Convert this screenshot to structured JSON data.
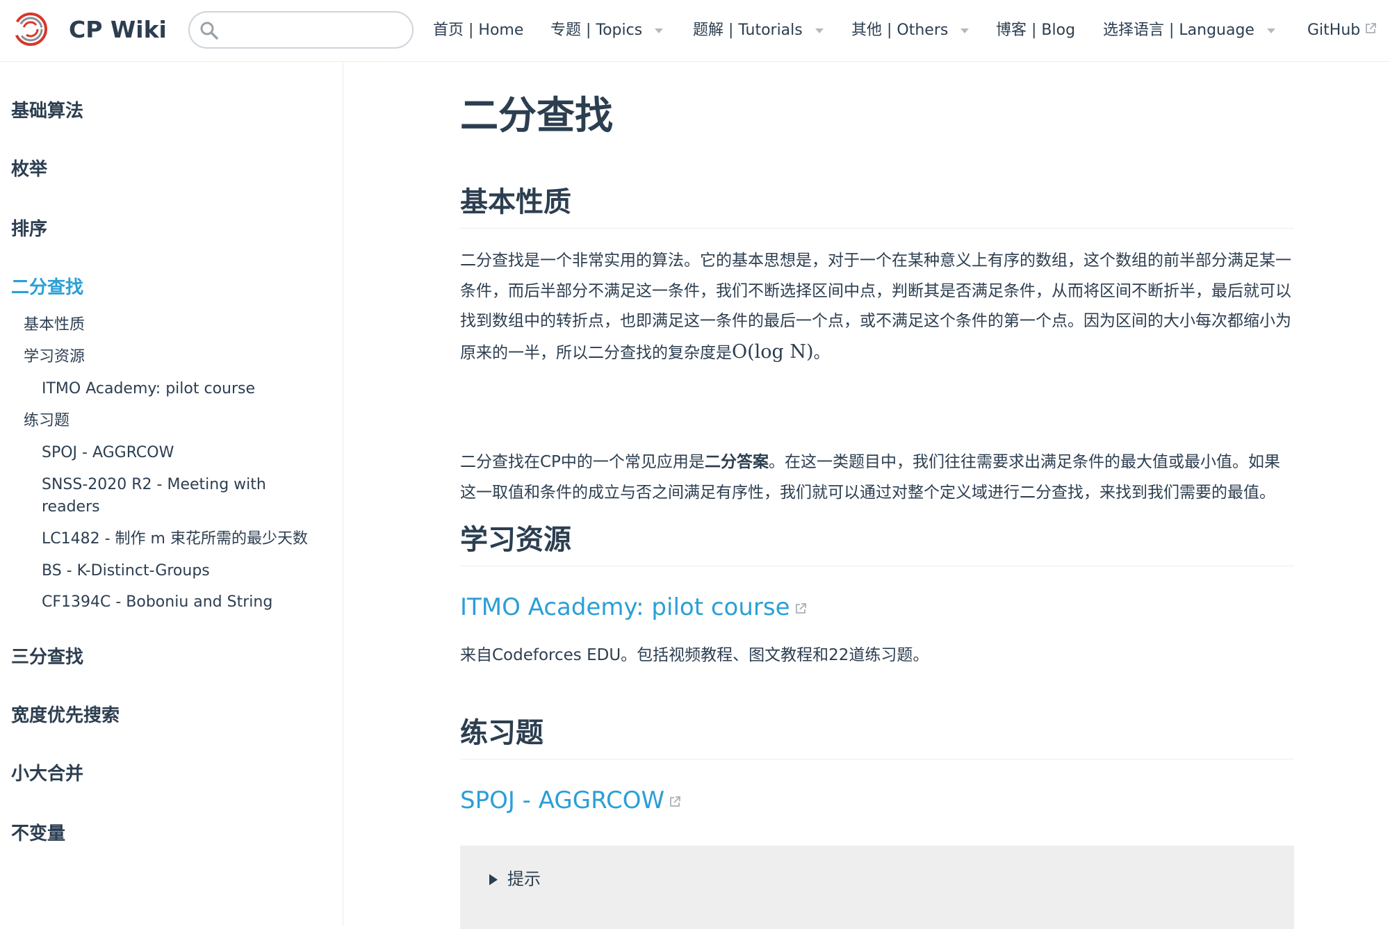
{
  "navbar": {
    "site_name": "CP Wiki",
    "search_placeholder": "",
    "items": [
      {
        "label": "首页 | Home"
      },
      {
        "label": "专题 | Topics"
      },
      {
        "label": "题解 | Tutorials"
      },
      {
        "label": "其他 | Others"
      },
      {
        "label": "博客 | Blog"
      },
      {
        "label": "选择语言 | Language"
      },
      {
        "label": "GitHub"
      }
    ]
  },
  "sidebar": {
    "groups": [
      {
        "label": "基础算法"
      },
      {
        "label": "枚举"
      },
      {
        "label": "排序"
      },
      {
        "label": "二分查找"
      },
      {
        "label": "三分查找"
      },
      {
        "label": "宽度优先搜索"
      },
      {
        "label": "小大合并"
      },
      {
        "label": "不变量"
      }
    ],
    "active_children": [
      {
        "label": "基本性质"
      },
      {
        "label": "学习资源"
      },
      {
        "label": "ITMO Academy: pilot course"
      },
      {
        "label": "练习题"
      },
      {
        "label": "SPOJ - AGGRCOW"
      },
      {
        "label": "SNSS-2020 R2 - Meeting with readers"
      },
      {
        "label": "LC1482 - 制作 m 束花所需的最少天数"
      },
      {
        "label": "BS - K-Distinct-Groups"
      },
      {
        "label": "CF1394C - Boboniu and String"
      }
    ]
  },
  "content": {
    "title": "二分查找",
    "sections": {
      "basic": {
        "heading": "基本性质",
        "p1": "二分查找是一个非常实用的算法。它的基本思想是，对于一个在某种意义上有序的数组，这个数组的前半部分满足某一条件，而后半部分不满足这一条件，我们不断选择区间中点，判断其是否满足条件，从而将区间不断折半，最后就可以找到数组中的转折点，也即满足这一条件的最后一个点，或不满足这个条件的第一个点。因为区间的大小每次都缩小为原来的一半，所以二分查找的复杂度是",
        "p1_math": "O(log N)",
        "p1_end": "。",
        "p2_a": "二分查找在CP中的一个常见应用是",
        "p2_bold": "二分答案",
        "p2_b": "。在这一类题目中，我们往往需要求出满足条件的最大值或最小值。如果这一取值和条件的成立与否之间满足有序性，我们就可以通过对整个定义域进行二分查找，来找到我们需要的最值。"
      },
      "resources": {
        "heading": "学习资源",
        "link": "ITMO Academy: pilot course",
        "desc": "来自Codeforces EDU。包括视频教程、图文教程和22道练习题。"
      },
      "practice": {
        "heading": "练习题",
        "link": "SPOJ - AGGRCOW",
        "hint": "提示"
      }
    }
  },
  "colors": {
    "text": "#2c3e50",
    "accent": "#2a9fd6",
    "divider": "#eaecef",
    "details_bg": "#eeeeee"
  },
  "icons": [
    "logo-icon",
    "search-icon",
    "chevron-down-icon",
    "external-link-icon",
    "triangle-right-icon"
  ]
}
